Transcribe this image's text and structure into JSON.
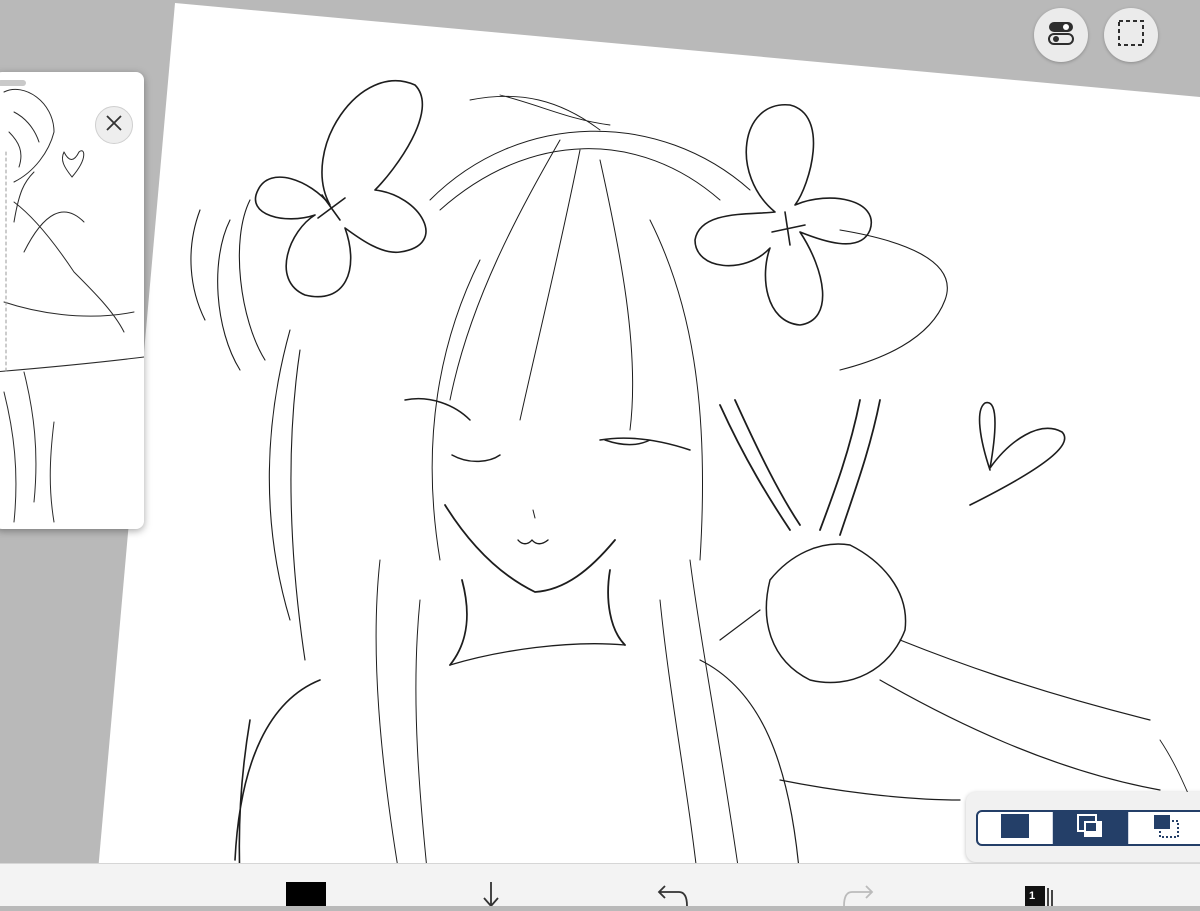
{
  "app": {
    "name": "drawing-canvas"
  },
  "toolbar_top": {
    "toggle_icon": "toggle-switch-icon",
    "selection_icon": "dashed-selection-icon"
  },
  "reference_panel": {
    "close_icon": "close-icon"
  },
  "blend_panel": {
    "options": [
      "normal-layer-icon",
      "clipping-layer-icon",
      "mask-layer-icon"
    ],
    "selected_index": 1,
    "accent": "#243f68"
  },
  "bottom_bar": {
    "color_swatch": "#000000",
    "download_icon": "download-arrow-icon",
    "undo_icon": "undo-icon",
    "redo_icon": "redo-icon",
    "layer_count": "1"
  },
  "colors": {
    "background": "#b9b9b9",
    "paper": "#ffffff",
    "ink": "#1a1a1a",
    "bar": "#f3f3f3"
  }
}
